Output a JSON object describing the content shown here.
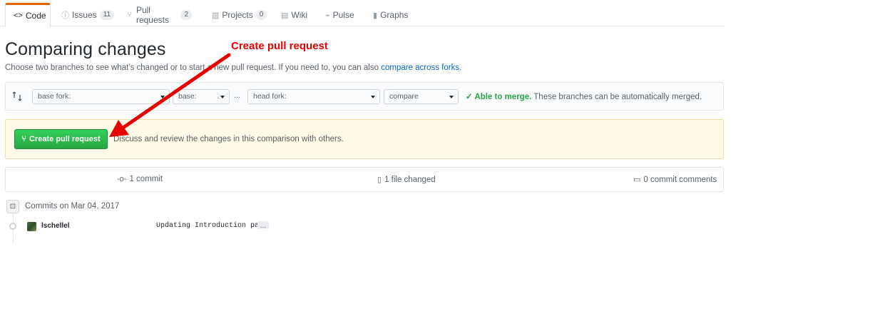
{
  "tabs": [
    {
      "icon": "code-icon",
      "label": "Code",
      "count": null,
      "selected": true
    },
    {
      "icon": "issue-icon",
      "label": "Issues",
      "count": "11",
      "selected": false
    },
    {
      "icon": "pull-request-icon",
      "label": "Pull requests",
      "count": "2",
      "selected": false
    },
    {
      "icon": "project-icon",
      "label": "Projects",
      "count": "0",
      "selected": false
    },
    {
      "icon": "wiki-icon",
      "label": "Wiki",
      "count": null,
      "selected": false
    },
    {
      "icon": "pulse-icon",
      "label": "Pulse",
      "count": null,
      "selected": false
    },
    {
      "icon": "graph-icon",
      "label": "Graphs",
      "count": null,
      "selected": false
    }
  ],
  "page": {
    "title": "Comparing changes",
    "description_prefix": "Choose two branches to see what’s changed or to start a new pull request. If you need to, you can also ",
    "compare_link": "compare across forks",
    "description_suffix": "."
  },
  "range": {
    "base_fork_label": "base fork:",
    "base_label": "base:",
    "base_value": ".",
    "dots": "...",
    "head_fork_label": "head fork:",
    "compare_label": "compare",
    "merge_ok": "✓ Able to merge.",
    "merge_text": " These branches can be automatically merged."
  },
  "pr_banner": {
    "button_label": "Create pull request",
    "description": "Discuss and review the changes in this comparison with others."
  },
  "stats": {
    "commits": "1 commit",
    "files": "1 file changed",
    "comments": "0 commit comments"
  },
  "commits": {
    "group_title": "Commits on Mar 04, 2017",
    "items": [
      {
        "author": "lschellel",
        "message": "Updating Introduction page",
        "more": "…"
      }
    ]
  },
  "annotation": {
    "label": "Create pull request",
    "color": "#e60000"
  },
  "colors": {
    "accent_tab": "#e36209",
    "merge_ok": "#28a745",
    "button_green": "#28a745",
    "banner_bg": "#fffbe6",
    "link": "#0366d6"
  }
}
